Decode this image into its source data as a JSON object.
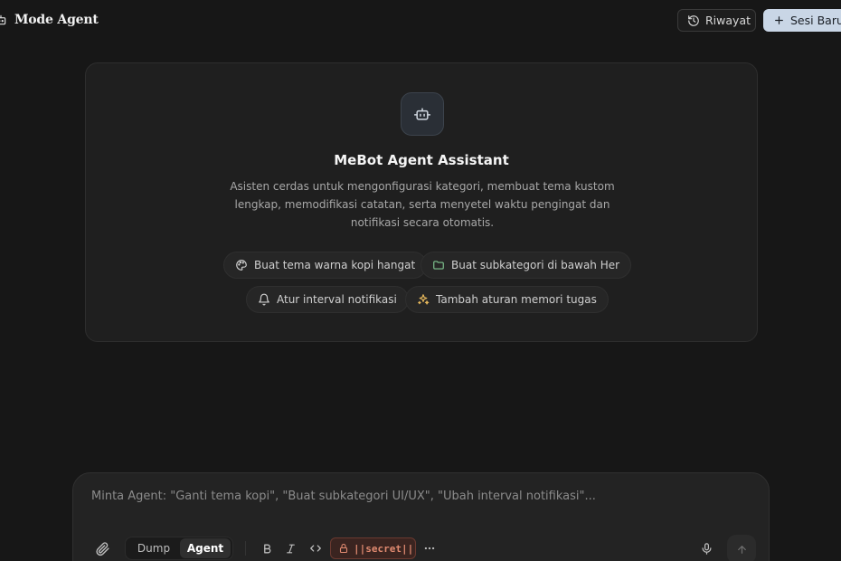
{
  "header": {
    "title": "Mode Agent",
    "history_label": "Riwayat",
    "new_session_label": "Sesi Baru"
  },
  "welcome": {
    "title": "MeBot Agent Assistant",
    "description": "Asisten cerdas untuk mengonfigurasi kategori, membuat tema kustom lengkap, memodifikasi catatan, serta menyetel waktu pengingat dan notifikasi secara otomatis.",
    "suggestions": [
      {
        "label": "Buat tema warna kopi hangat",
        "icon": "palette-icon"
      },
      {
        "label": "Buat subkategori di bawah Her",
        "icon": "folder-icon"
      },
      {
        "label": "Atur interval notifikasi",
        "icon": "bell-icon"
      },
      {
        "label": "Tambah aturan memori tugas",
        "icon": "sparkles-icon"
      }
    ]
  },
  "composer": {
    "placeholder": "Minta Agent: \"Ganti tema kopi\", \"Buat subkategori UI/UX\", \"Ubah interval notifikasi\"...",
    "value": "",
    "modes": [
      "Dump",
      "Agent"
    ],
    "active_mode": "Agent",
    "secret_label": "||secret||"
  },
  "colors": {
    "background": "#171717",
    "card": "#1f1f1f",
    "accent_button": "#c9d6e6",
    "secret": "#e08a70",
    "folder_icon": "#7fc48f",
    "sparkles_icon": "#e6b85c"
  }
}
